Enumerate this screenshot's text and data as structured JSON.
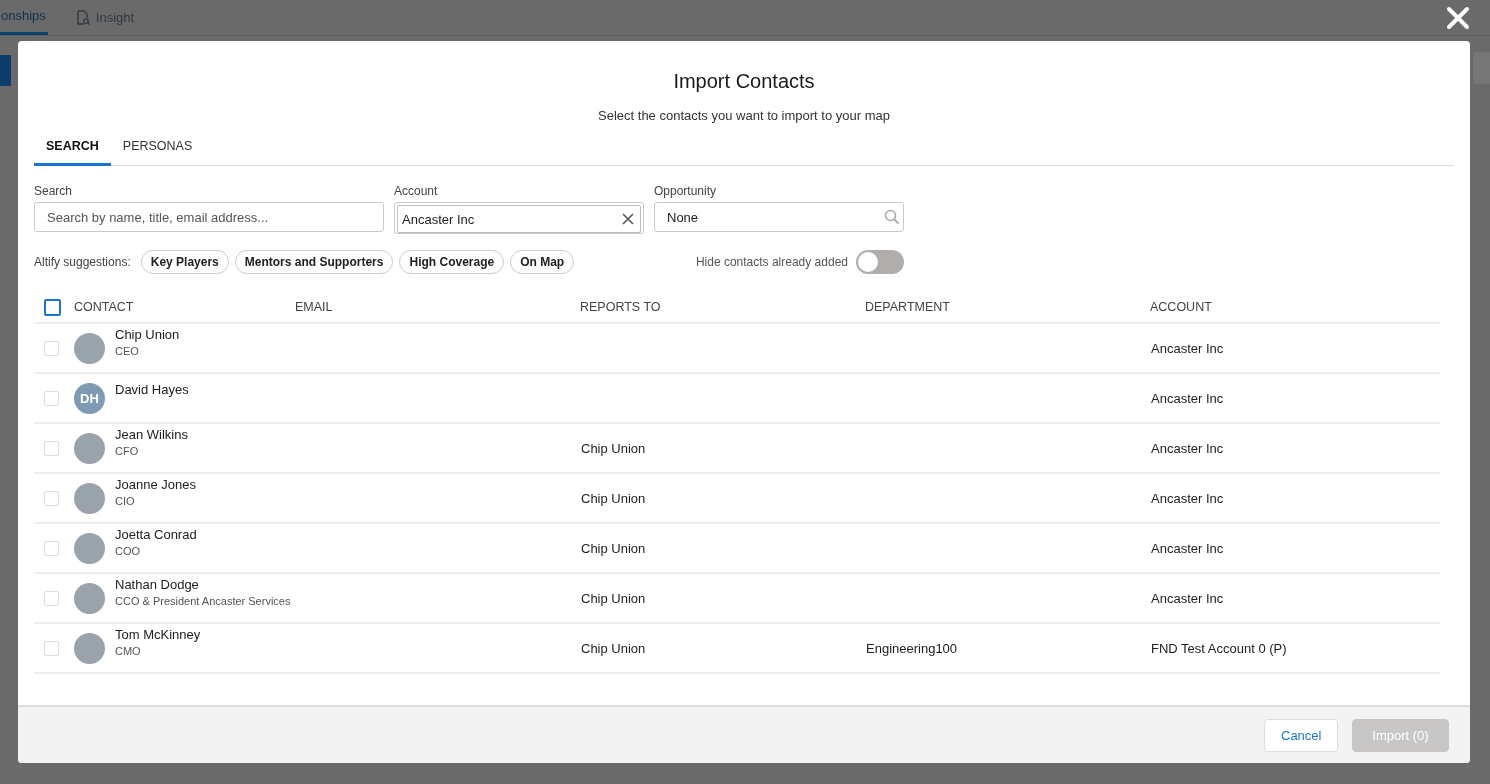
{
  "background_tabs": [
    {
      "label": "onships",
      "icon": false,
      "selected": true
    },
    {
      "label": "Insight",
      "icon": true,
      "selected": false
    }
  ],
  "dialog": {
    "title": "Import Contacts",
    "subtitle": "Select the contacts you want to import to your map",
    "tabs": [
      {
        "label": "SEARCH",
        "selected": true
      },
      {
        "label": "PERSONAS",
        "selected": false
      }
    ],
    "filters": {
      "search": {
        "label": "Search",
        "placeholder": "Search by name, title, email address..."
      },
      "account": {
        "label": "Account",
        "value": "Ancaster Inc"
      },
      "opportunity": {
        "label": "Opportunity",
        "value": "None"
      }
    },
    "suggestions": {
      "label": "Altify suggestions:",
      "chips": [
        "Key Players",
        "Mentors and Supporters",
        "High Coverage",
        "On Map"
      ]
    },
    "hide_added": {
      "label": "Hide contacts already added",
      "on": false
    },
    "table": {
      "select_all": false,
      "columns": [
        "CONTACT",
        "EMAIL",
        "REPORTS TO",
        "DEPARTMENT",
        "ACCOUNT"
      ],
      "rows": [
        {
          "checked": false,
          "kind": "photo",
          "name": "Chip Union",
          "title": "CEO",
          "account": "Ancaster Inc"
        },
        {
          "checked": false,
          "kind": "initials",
          "initials": "DH",
          "name": "David Hayes",
          "account": "Ancaster Inc"
        },
        {
          "checked": false,
          "kind": "photo",
          "name": "Jean Wilkins",
          "title": "CFO",
          "reports_to": "Chip Union",
          "account": "Ancaster Inc"
        },
        {
          "checked": false,
          "kind": "photo",
          "name": "Joanne Jones",
          "title": "CIO",
          "reports_to": "Chip Union",
          "account": "Ancaster Inc"
        },
        {
          "checked": false,
          "kind": "photo",
          "name": "Joetta Conrad",
          "title": "COO",
          "reports_to": "Chip Union",
          "account": "Ancaster Inc"
        },
        {
          "checked": false,
          "kind": "photo",
          "name": "Nathan Dodge",
          "title": "CCO & President Ancaster Services",
          "reports_to": "Chip Union",
          "account": "Ancaster Inc"
        },
        {
          "checked": false,
          "kind": "photo",
          "name": "Tom McKinney",
          "title": "CMO",
          "reports_to": "Chip Union",
          "department": "Engineering100",
          "account": "FND Test Account 0 (P)"
        }
      ]
    },
    "buttons": [
      {
        "label": "Cancel",
        "disabled": false
      },
      {
        "label": "Import (0)",
        "disabled": true
      }
    ]
  }
}
